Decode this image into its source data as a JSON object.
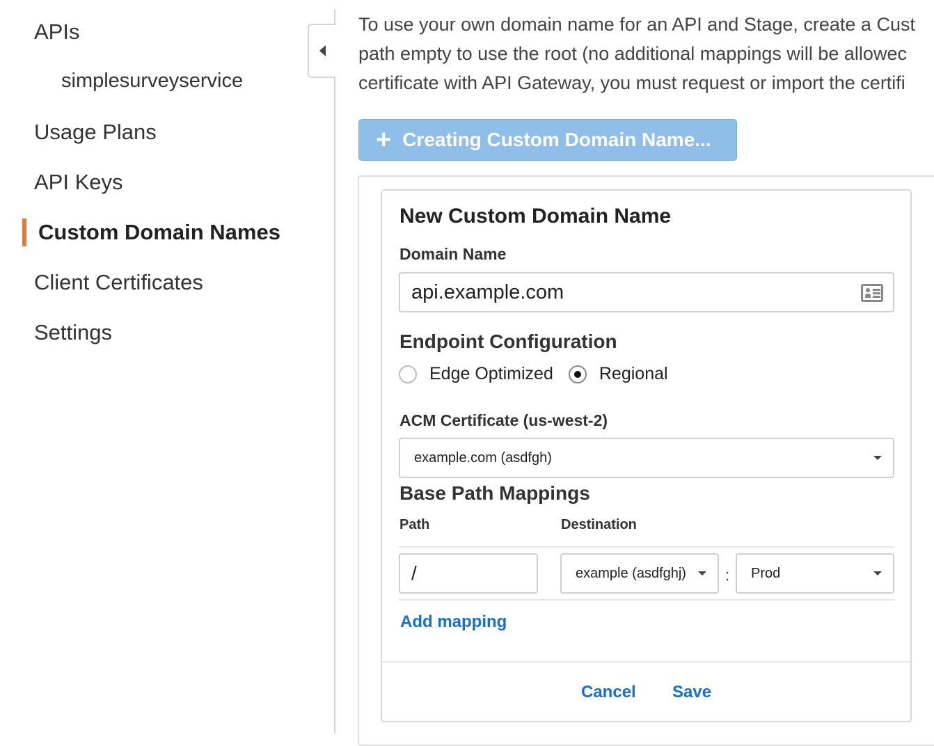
{
  "sidebar": {
    "items": [
      {
        "label": "APIs"
      },
      {
        "label": "simplesurveyservice"
      },
      {
        "label": "Usage Plans"
      },
      {
        "label": "API Keys"
      },
      {
        "label": "Custom Domain Names"
      },
      {
        "label": "Client Certificates"
      },
      {
        "label": "Settings"
      }
    ],
    "active_color": "#e07b39"
  },
  "intro": {
    "lines": [
      "To use your own domain name for an API and Stage, create a Cust",
      "path empty to use the root (no additional mappings will be allowec",
      "certificate with API Gateway, you must request or import the certifi"
    ]
  },
  "create_button": {
    "icon": "plus-icon",
    "label": "Creating Custom Domain Name..."
  },
  "form": {
    "title": "New Custom Domain Name",
    "domain_name": {
      "label": "Domain Name",
      "value": "api.example.com",
      "icon": "contact-card-icon"
    },
    "endpoint": {
      "title": "Endpoint Configuration",
      "options": [
        {
          "label": "Edge Optimized",
          "checked": false
        },
        {
          "label": "Regional",
          "checked": true
        }
      ]
    },
    "acm": {
      "label": "ACM Certificate (us-west-2)",
      "value": "example.com (asdfgh)"
    },
    "mappings": {
      "title": "Base Path Mappings",
      "path_header": "Path",
      "destination_header": "Destination",
      "rows": [
        {
          "path": "/",
          "api": "example (asdfghj)",
          "separator": ":",
          "stage": "Prod"
        }
      ],
      "add_label": "Add mapping"
    },
    "cancel_label": "Cancel",
    "save_label": "Save",
    "link_color": "#1a6fc6"
  }
}
